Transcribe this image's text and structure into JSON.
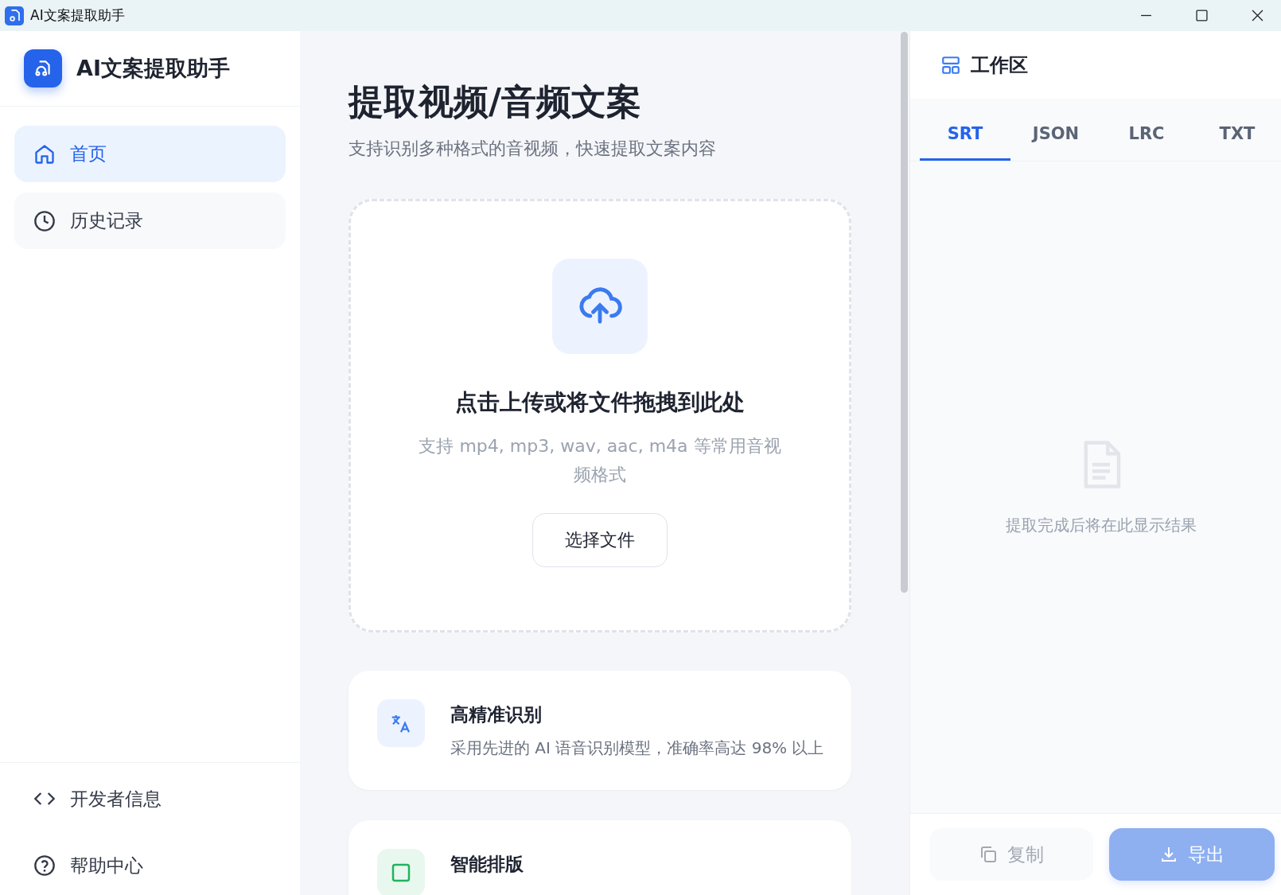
{
  "window": {
    "title": "AI文案提取助手"
  },
  "sidebar": {
    "app_name": "AI文案提取助手",
    "items": [
      {
        "label": "首页",
        "kind": "home",
        "selected": true
      },
      {
        "label": "历史记录",
        "kind": "history",
        "selected": false
      }
    ],
    "footer_items": [
      {
        "label": "开发者信息",
        "kind": "developer"
      },
      {
        "label": "帮助中心",
        "kind": "help"
      }
    ]
  },
  "main": {
    "title": "提取视频/音频文案",
    "subtitle": "支持识别多种格式的音视频，快速提取文案内容",
    "upload": {
      "title": "点击上传或将文件拖拽到此处",
      "hint": "支持 mp4, mp3, wav, aac, m4a 等常用音视频格式",
      "button": "选择文件"
    },
    "features": [
      {
        "kind": "accuracy",
        "title": "高精准识别",
        "text": "采用先进的 AI 语音识别模型，准确率高达 98% 以上"
      },
      {
        "kind": "formatting",
        "title": "智能排版"
      }
    ]
  },
  "workspace": {
    "title": "工作区",
    "tabs": [
      {
        "label": "SRT",
        "selected": true
      },
      {
        "label": "JSON",
        "selected": false
      },
      {
        "label": "LRC",
        "selected": false
      },
      {
        "label": "TXT",
        "selected": false
      }
    ],
    "empty_text": "提取完成后将在此显示结果",
    "buttons": [
      {
        "label": "复制",
        "kind": "copy",
        "disabled": true
      },
      {
        "label": "导出",
        "kind": "export",
        "disabled": true
      }
    ]
  }
}
